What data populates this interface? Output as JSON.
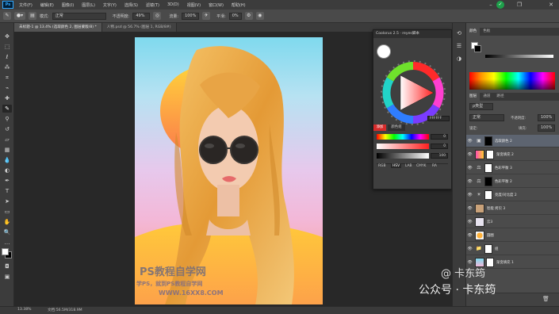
{
  "menubar": {
    "logo": "Ps",
    "items": [
      "文件(F)",
      "编辑(E)",
      "图像(I)",
      "图层(L)",
      "文字(Y)",
      "选择(S)",
      "滤镜(T)",
      "3D(D)",
      "视图(V)",
      "窗口(W)",
      "帮助(H)"
    ]
  },
  "options": {
    "mode_label": "模式:",
    "mode_value": "正常",
    "opacity_label": "不透明度:",
    "opacity_value": "49%",
    "flow_label": "流量:",
    "flow_value": "100%",
    "smoothing_label": "平滑:",
    "smoothing_value": "0%"
  },
  "tabs": [
    "未标题-1 @ 13.4% (选取颜色 2, 图层蒙版/8) *",
    "人物.psd @ 56.7% (图层 1, RGB/8#)"
  ],
  "status": {
    "zoom": "13.38%",
    "doc_size": "文档:56.5M/318.9M"
  },
  "wheel_panel": {
    "title": "Coolorus 2.5 · reyes脚本",
    "hex": "FFFFFF",
    "btn_left": "添加",
    "btn_right": "颜色组",
    "slider_values": [
      "0",
      "0",
      "100"
    ],
    "modes": [
      "RGB",
      "HSV",
      "LAB",
      "CMYK",
      "RA"
    ]
  },
  "color_panel": {
    "tabs": [
      "颜色",
      "色板"
    ]
  },
  "layers_panel": {
    "tabs": [
      "图层",
      "通道",
      "路径"
    ],
    "kind_filter": "ρ类型",
    "blend_mode": "正常",
    "opacity_label": "不透明度:",
    "opacity_value": "100%",
    "lock_label": "锁定:",
    "fill_label": "填充:",
    "fill_value": "100%",
    "layers": [
      {
        "name": "选取颜色 2",
        "selected": true
      },
      {
        "name": "渐变填充 2",
        "selected": false
      },
      {
        "name": "色彩平衡 3",
        "selected": false
      },
      {
        "name": "色彩平衡 2",
        "selected": false
      },
      {
        "name": "亮度/对比度 2",
        "selected": false
      },
      {
        "name": "智能 拷贝 3",
        "selected": false
      },
      {
        "name": "云3",
        "selected": false
      },
      {
        "name": "圆圈",
        "selected": false
      },
      {
        "name": "组",
        "selected": false
      },
      {
        "name": "渐变填充 1",
        "selected": false
      }
    ]
  },
  "watermarks": {
    "line1": "PS教程自学网",
    "line2": "学PS，就到PS教程自学网",
    "line3": "WWW.16XX8.COM",
    "social_line1": "@ 卡东筠",
    "social_line2": "公众号 · 卡东筠"
  },
  "colors": {
    "accent_green": "#1e9e4a",
    "foreground": "#ffffff",
    "background": "#000000"
  }
}
